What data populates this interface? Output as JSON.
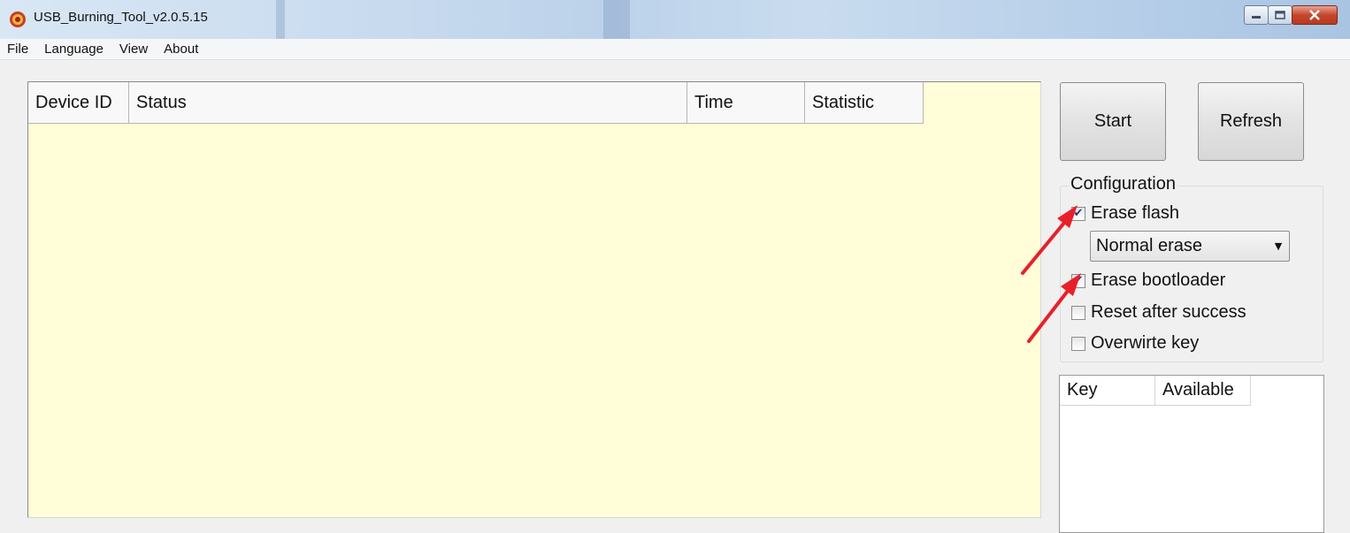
{
  "window": {
    "title": "USB_Burning_Tool_v2.0.5.15",
    "app_icon": "amlogic-burn-icon",
    "controls": [
      "minimize-icon",
      "maximize-icon",
      "close-icon"
    ]
  },
  "menu": {
    "items": [
      "File",
      "Language",
      "View",
      "About"
    ]
  },
  "device_table": {
    "columns": [
      "Device ID",
      "Status",
      "Time",
      "Statistic"
    ],
    "rows": []
  },
  "actions": {
    "start_label": "Start",
    "refresh_label": "Refresh"
  },
  "configuration": {
    "title": "Configuration",
    "options": [
      {
        "label": "Erase flash",
        "checked": true
      },
      {
        "label": "Erase bootloader",
        "checked": true
      },
      {
        "label": "Reset after success",
        "checked": false
      },
      {
        "label": "Overwirte key",
        "checked": false
      }
    ],
    "erase_mode": {
      "selected": "Normal erase"
    }
  },
  "key_table": {
    "columns": [
      "Key",
      "Available"
    ],
    "rows": []
  },
  "colors": {
    "device_list_bg": "#fffed8",
    "annotation_arrow": "#e8202a"
  }
}
